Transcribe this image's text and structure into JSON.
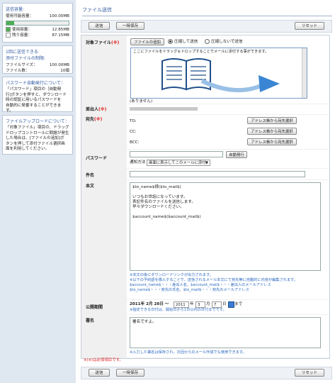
{
  "sidebar": {
    "storage": {
      "heading": "送信容量:",
      "available_label": "使用可能容量：",
      "available_value": "100.00MB",
      "used_label": "使用容量：",
      "used_value": "12.85MB",
      "remaining_label": "残り容量：",
      "remaining_value": "87.15MB",
      "used_fraction": 0.13
    },
    "limits": {
      "heading1": "1回に送信できる",
      "heading2": "添付ファイルの制限:",
      "size_label": "ファイルサイズ：",
      "size_value": "100.00MB",
      "count_label": "ファイル数：",
      "count_value": "10個"
    },
    "password_help": {
      "heading": "パスワード自動発行について：",
      "body": [
        "「パスワード」項目の［自動発",
        "行]ボタンを押すと、ダウンロード",
        "時の認証に用いるパスワードを",
        "自動的に発番することができま",
        "す。"
      ]
    },
    "upload_help": {
      "heading": "ファイルアップロードについて：",
      "body": [
        "「対象ファイル」項目の、ドラッグ",
        "ドロップコントロールに問題が発生",
        "した場合は、[ファイルの追加]ボ",
        "タンを押して添付ファイル選択画",
        "面を利用してください。"
      ]
    }
  },
  "page_title": "ファイル送信",
  "toolbar": {
    "send": "送信",
    "save_draft": "一時保存",
    "reset": "リセット"
  },
  "form": {
    "file_label": "対象ファイル",
    "required_mark": "(※)",
    "add_file_button": "ファイルの追加",
    "compress_on": "圧縮して送信",
    "compress_off": "圧縮しないで送信",
    "drop_hint": "ここにファイルをドラッグ＆ドロップすることでメールに添付する事ができます。",
    "no_file_text": "(ありません)",
    "sender_label": "差出人",
    "sender_value": "",
    "to_label": "宛先",
    "to_field": "TO:",
    "cc_field": "CC:",
    "bcc_field": "BCC:",
    "address_book_button": "アドレス帳から宛先選択",
    "password_label": "パスワード",
    "auto_issue_button": "自動発行",
    "notify_label": "通知方法",
    "notify_value": "画面に表示してこのメールに添付",
    "subject_label": "件名",
    "body_label": "本文",
    "body_lines": [
      "$to_name$様($to_mail$)",
      "",
      "いつもお世話になっています。",
      "表記件名のファイルを送信します。",
      "早々ダウンロードください。",
      "",
      "$account_name$($account_mail$)"
    ],
    "body_notes": [
      "※本文の後にダウンロードリンクが出力されます。",
      "※以下の予約語を挿入することで、送信されるメール本文にて宛先等に自動的に内容が編集されます。",
      "$account_name$・・・差出人名、$account_mail$・・・差出人のメールアドレス",
      "$to_name$・・・宛先の氏名、$to_mail$・・・宛先のメールアドレス"
    ],
    "period_label": "公開期間",
    "period_start": "2011年 2月 28日 ～",
    "period_year": "2011",
    "period_year_unit": "年",
    "period_month": "3",
    "period_month_unit": "月",
    "period_day": "7",
    "period_day_unit": "日",
    "period_suffix": "まで",
    "period_note": "※指定できる日付は、開始日から1日以内の日付までです。",
    "signature_label": "署名",
    "signature_value": "署名ですよ。",
    "signature_note": "※入力した署名は保存され、次回からのメール作成でも使用できます。",
    "required_note": "※(※)は必須項目です。"
  },
  "colors": {
    "sidebar_bg": "#dfe7f1",
    "title": "#2f5aa0",
    "required": "#e02020",
    "note": "#2a68c0"
  }
}
